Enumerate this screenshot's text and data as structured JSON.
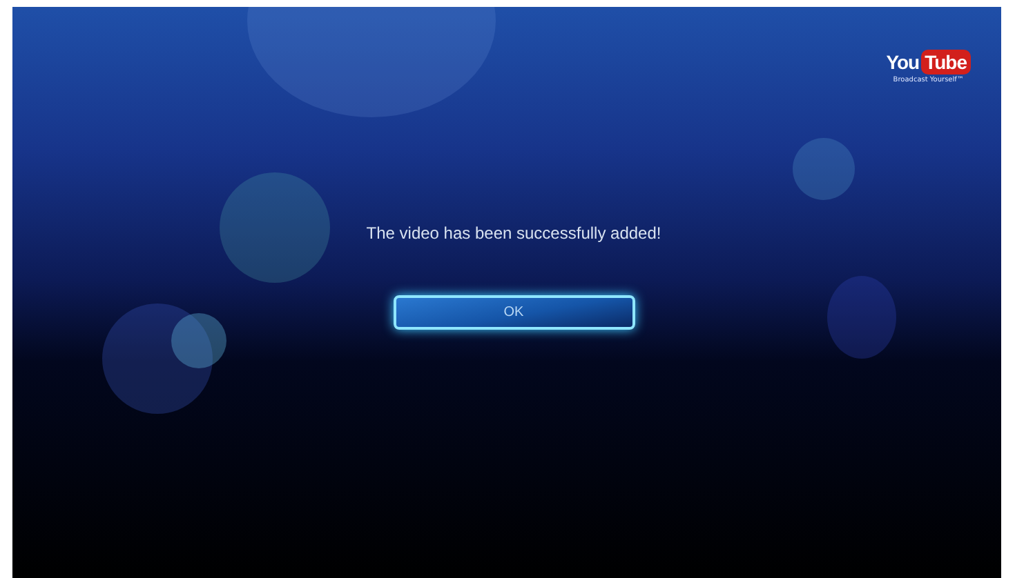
{
  "logo": {
    "word_1": "You",
    "word_2": "Tube",
    "tagline": "Broadcast Yourself™"
  },
  "dialog": {
    "message": "The video has been successfully added!",
    "button": "OK"
  }
}
